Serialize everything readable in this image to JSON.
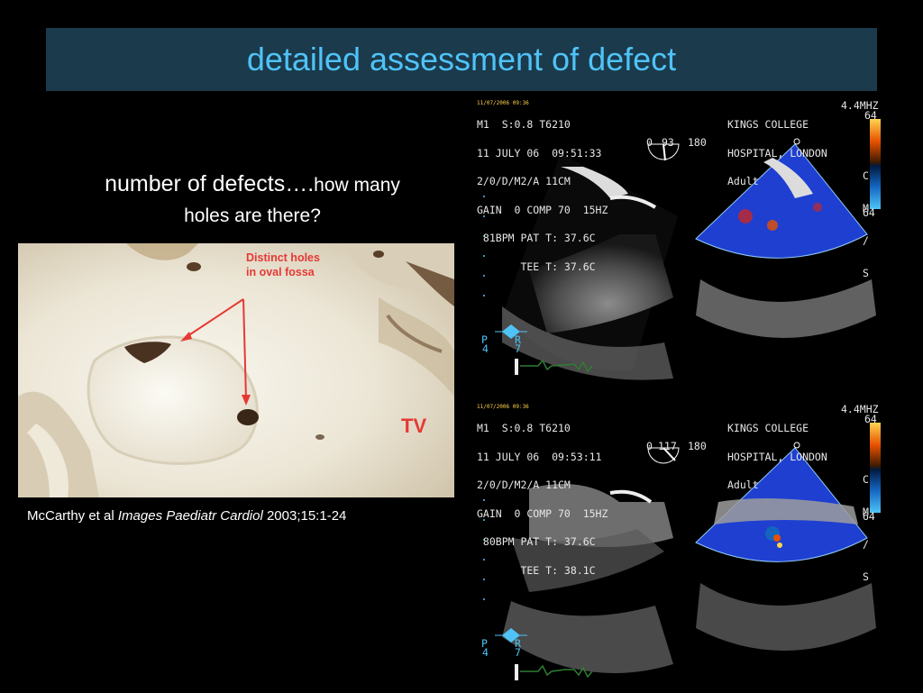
{
  "slide": {
    "title": "detailed assessment of defect",
    "question_main": "number of defects….",
    "question_sub1": "how many",
    "question_sub2": "holes are there?",
    "citation": {
      "authors": "McCarthy et al ",
      "journal": "Images Paediatr Cardiol",
      "ref": " 2003;15:1-24"
    }
  },
  "specimen": {
    "annotation_line1": "Distinct holes",
    "annotation_line2": "in oval fossa",
    "label_tv": "TV",
    "arrow_color": "#e53935"
  },
  "echo_top": {
    "date_tag": "11/07/2006 09:36",
    "line1": "M1  S:0.8 T6210",
    "line2": "11 JULY 06  09:51:33",
    "line3": "2/0/D/M2/A 11CM",
    "line4": "GAIN  0 COMP 70  15HZ",
    "line5": " 81BPM PAT T: 37.6C",
    "line6": "       TEE T: 37.6C",
    "angle_left": "0",
    "angle_value": "93",
    "angle_right": "180",
    "hospital_line1": "KINGS COLLEGE",
    "hospital_line2": "HOSPITAL, LONDON",
    "hospital_line3": "Adult",
    "freq": "4.4MHZ",
    "scale_top": "64",
    "scale_bottom": "64",
    "cms_letters": [
      "C",
      "M",
      "/",
      "S"
    ],
    "probe_p": "P",
    "probe_r": "R",
    "probe_4": "4",
    "probe_7": "7"
  },
  "echo_bottom": {
    "date_tag": "11/07/2006 09:36",
    "line1": "M1  S:0.8 T6210",
    "line2": "11 JULY 06  09:53:11",
    "line3": "2/0/D/M2/A 11CM",
    "line4": "GAIN  0 COMP 70  15HZ",
    "line5": " 80BPM PAT T: 37.6C",
    "line6": "       TEE T: 38.1C",
    "angle_left": "0",
    "angle_value": "117",
    "angle_right": "180",
    "hospital_line1": "KINGS COLLEGE",
    "hospital_line2": "HOSPITAL, LONDON",
    "hospital_line3": "Adult",
    "freq": "4.4MHZ",
    "scale_top": "64",
    "scale_bottom": "64",
    "cms_letters": [
      "C",
      "M",
      "/",
      "S"
    ],
    "probe_p": "P",
    "probe_r": "R",
    "probe_4": "4",
    "probe_7": "7"
  },
  "colors": {
    "background": "#000000",
    "title_bar": "#1b3a4b",
    "title_text": "#4fc3f7",
    "ecg_trace": "#2e7d32",
    "doppler_blue": "#1e3fd0"
  }
}
